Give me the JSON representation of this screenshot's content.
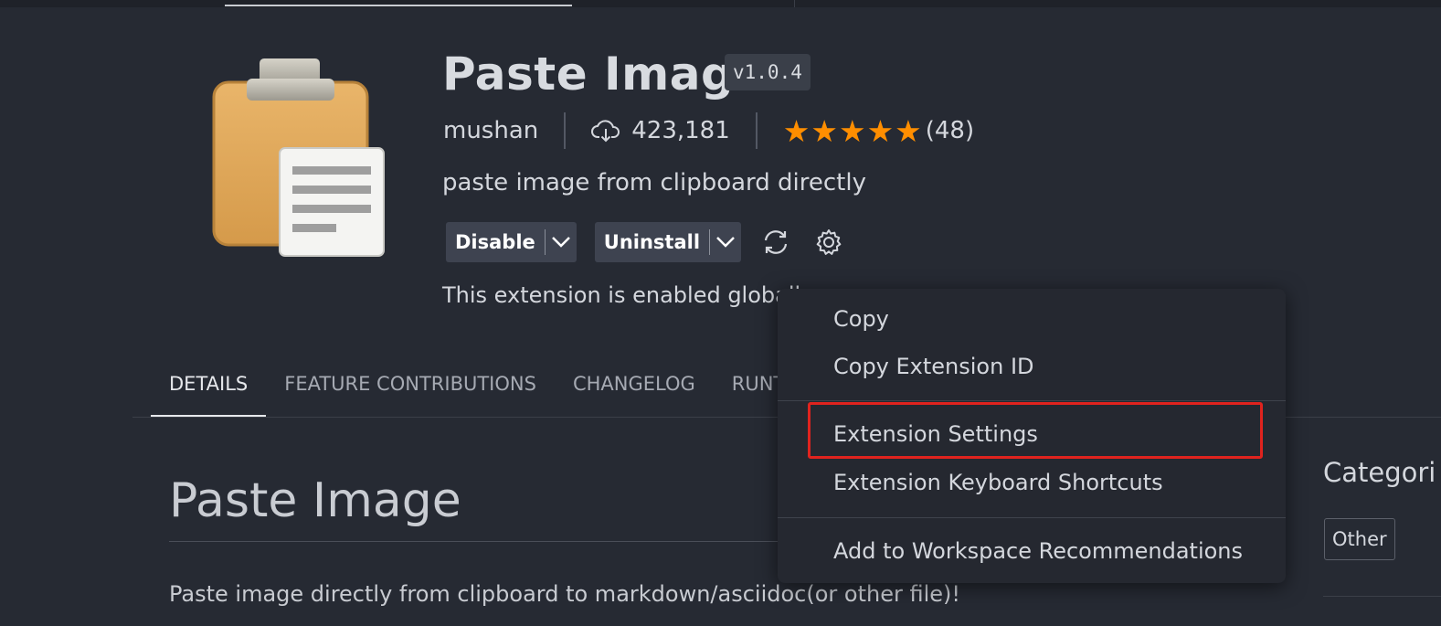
{
  "extension": {
    "name": "Paste Image",
    "version": "v1.0.4",
    "publisher": "mushan",
    "install_count": "423,181",
    "rating_stars": 5,
    "rating_count": "(48)",
    "description": "paste image from clipboard directly",
    "status": "This extension is enabled globally"
  },
  "actions": {
    "disable_label": "Disable",
    "uninstall_label": "Uninstall"
  },
  "tabs": [
    {
      "label": "DETAILS",
      "active": true
    },
    {
      "label": "FEATURE CONTRIBUTIONS",
      "active": false
    },
    {
      "label": "CHANGELOG",
      "active": false
    },
    {
      "label": "RUNT",
      "active": false
    }
  ],
  "readme": {
    "title": "Paste Image",
    "intro": "Paste image directly from clipboard to markdown/asciidoc(or other file)!"
  },
  "sidebar": {
    "categories_heading": "Categori",
    "category_tag": "Other"
  },
  "context_menu": {
    "items": [
      {
        "label": "Copy"
      },
      {
        "label": "Copy Extension ID"
      },
      {
        "label": "Extension Settings",
        "highlighted": true
      },
      {
        "label": "Extension Keyboard Shortcuts"
      },
      {
        "label": "Add to Workspace Recommendations"
      }
    ]
  },
  "colors": {
    "background": "#262a33",
    "star": "#ff8e00",
    "highlight_border": "#e0231e",
    "button_bg": "#3e4350"
  },
  "icons": [
    "clipboard-logo-icon",
    "cloud-download-icon",
    "star-icon",
    "chevron-down-icon",
    "sync-icon",
    "gear-icon"
  ]
}
